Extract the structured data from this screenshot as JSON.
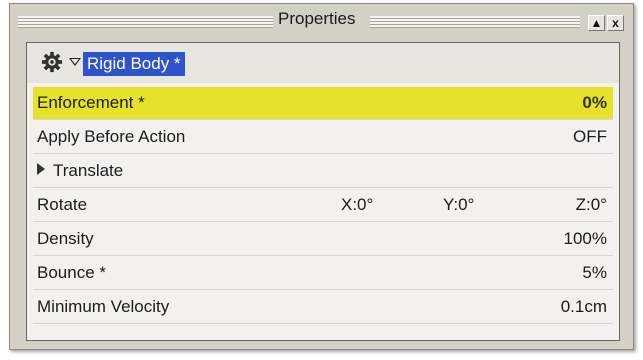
{
  "window": {
    "title": "Properties",
    "minimize_label": "▲",
    "close_label": "x"
  },
  "section": {
    "name": "Rigid Body *"
  },
  "properties": [
    {
      "label": "Enforcement *",
      "value": "0%"
    },
    {
      "label": "Apply Before Action",
      "value": "OFF"
    },
    {
      "label": "Translate",
      "value": ""
    },
    {
      "label": "Rotate",
      "x": "X:0°",
      "y": "Y:0°",
      "z": "Z:0°"
    },
    {
      "label": "Density",
      "value": "100%"
    },
    {
      "label": "Bounce *",
      "value": "5%"
    },
    {
      "label": "Minimum Velocity",
      "value": "0.1cm"
    }
  ],
  "colors": {
    "highlight": "#e6e229",
    "selection": "#2f53c9"
  },
  "icons": [
    "gear-icon",
    "expand-down-icon",
    "expand-right-icon"
  ]
}
